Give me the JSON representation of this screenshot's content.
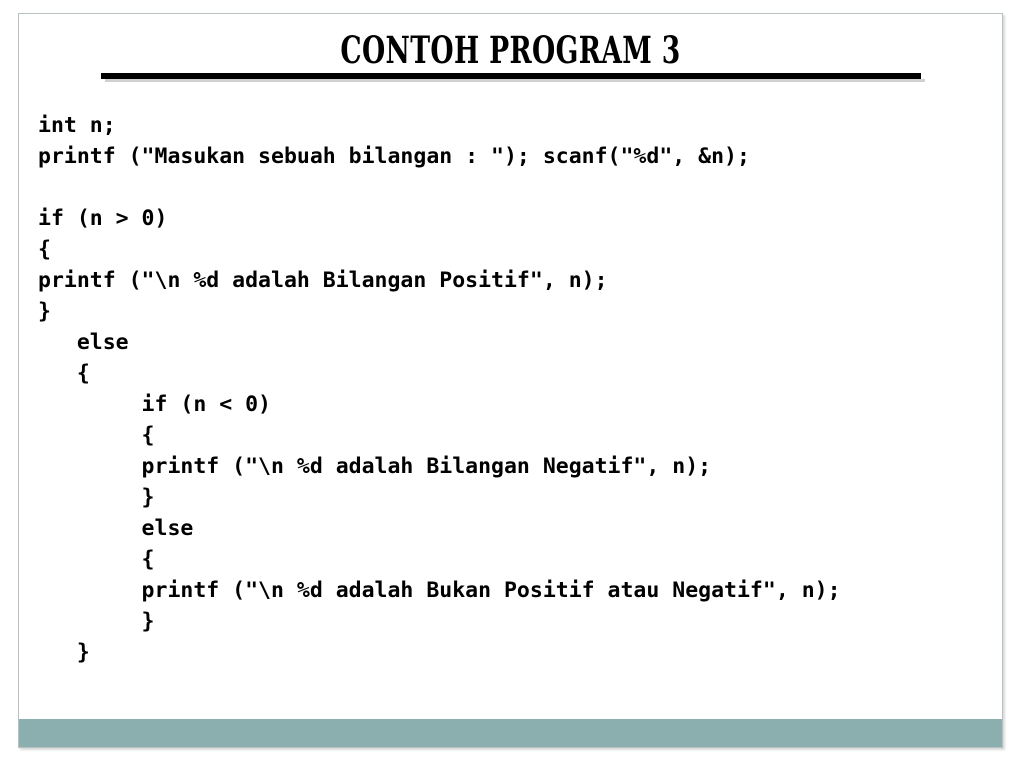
{
  "slide": {
    "title": "CONTOH PROGRAM 3",
    "accent_color": "#8bafae",
    "border_color": "#b9c2c2",
    "background_color": "#ffffff",
    "text_color": "#000000"
  },
  "code": {
    "language": "c",
    "lines": [
      "int n;",
      "printf (\"Masukan sebuah bilangan : \"); scanf(\"%d\", &n);",
      "",
      "if (n > 0)",
      "{",
      "printf (\"\\n %d adalah Bilangan Positif\", n);",
      "}",
      "   else",
      "   {",
      "        if (n < 0)",
      "        {",
      "        printf (\"\\n %d adalah Bilangan Negatif\", n);",
      "        }",
      "        else",
      "        {",
      "        printf (\"\\n %d adalah Bukan Positif atau Negatif\", n);",
      "        }",
      "   }"
    ]
  }
}
